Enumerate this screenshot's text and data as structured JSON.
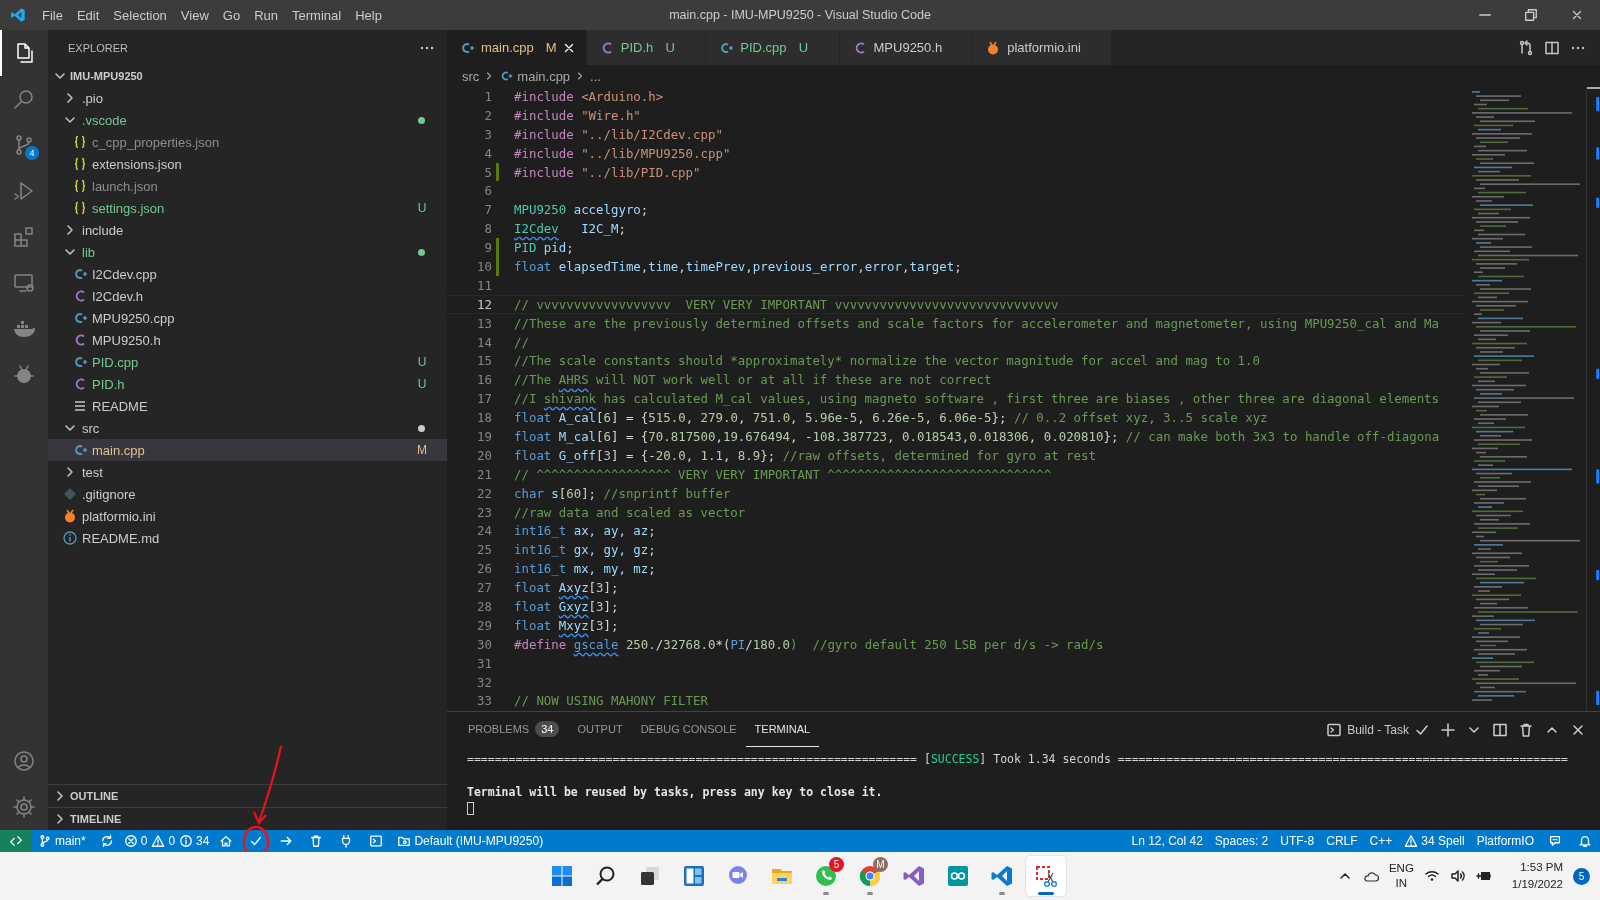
{
  "title_bar": {
    "menu": [
      "File",
      "Edit",
      "Selection",
      "View",
      "Go",
      "Run",
      "Terminal",
      "Help"
    ],
    "title": "main.cpp - IMU-MPU9250 - Visual Studio Code"
  },
  "activity_bar": {
    "items": [
      {
        "kind": "files",
        "selected": true
      },
      {
        "kind": "search",
        "selected": false
      },
      {
        "kind": "source-control",
        "selected": false,
        "badge": "4"
      },
      {
        "kind": "run",
        "selected": false
      },
      {
        "kind": "extensions",
        "selected": false
      },
      {
        "kind": "remote",
        "selected": false
      },
      {
        "kind": "docker",
        "selected": false
      },
      {
        "kind": "platformio",
        "selected": false
      }
    ],
    "bottom": [
      {
        "kind": "account"
      },
      {
        "kind": "settings"
      }
    ]
  },
  "explorer": {
    "title": "EXPLORER",
    "root": {
      "label": "IMU-MPU9250",
      "expanded": true,
      "children": [
        {
          "kind": "folder",
          "label": ".pio",
          "expanded": false,
          "dot": false,
          "color": "#cccccc",
          "selected": false
        },
        {
          "kind": "folder",
          "label": ".vscode",
          "expanded": true,
          "dot": true,
          "color": "#73c991",
          "selected": false,
          "children": [
            {
              "kind": "json",
              "label": "c_cpp_properties.json",
              "color": "#8c8c8c",
              "selected": false
            },
            {
              "kind": "json",
              "label": "extensions.json",
              "color": "#cccccc",
              "selected": false
            },
            {
              "kind": "json",
              "label": "launch.json",
              "color": "#8c8c8c",
              "selected": false
            },
            {
              "kind": "json",
              "label": "settings.json",
              "color": "#73c991",
              "badge": "U",
              "selected": false
            }
          ]
        },
        {
          "kind": "folder",
          "label": "include",
          "expanded": false,
          "dot": false,
          "color": "#cccccc",
          "selected": false
        },
        {
          "kind": "folder",
          "label": "lib",
          "expanded": true,
          "dot": true,
          "color": "#73c991",
          "selected": false,
          "children": [
            {
              "kind": "cpp",
              "label": "I2Cdev.cpp",
              "color": "#cccccc",
              "selected": false
            },
            {
              "kind": "header",
              "label": "I2Cdev.h",
              "color": "#cccccc",
              "selected": false
            },
            {
              "kind": "cpp",
              "label": "MPU9250.cpp",
              "color": "#cccccc",
              "selected": false
            },
            {
              "kind": "header",
              "label": "MPU9250.h",
              "color": "#cccccc",
              "selected": false
            },
            {
              "kind": "cpp",
              "label": "PID.cpp",
              "color": "#73c991",
              "badge": "U",
              "selected": false
            },
            {
              "kind": "header",
              "label": "PID.h",
              "color": "#73c991",
              "badge": "U",
              "selected": false
            },
            {
              "kind": "readme",
              "label": "README",
              "color": "#cccccc",
              "selected": false
            }
          ]
        },
        {
          "kind": "folder",
          "label": "src",
          "expanded": true,
          "dot": true,
          "color": "#cccccc",
          "selected": false,
          "children": [
            {
              "kind": "cpp",
              "label": "main.cpp",
              "color": "#e2c08d",
              "badge": "M",
              "selected": true
            }
          ]
        },
        {
          "kind": "folder",
          "label": "test",
          "expanded": false,
          "dot": false,
          "color": "#cccccc",
          "selected": false
        },
        {
          "kind": "gitignore",
          "label": ".gitignore",
          "color": "#cccccc",
          "selected": false
        },
        {
          "kind": "ini",
          "label": "platformio.ini",
          "color": "#cccccc",
          "selected": false
        },
        {
          "kind": "markdown",
          "label": "README.md",
          "color": "#cccccc",
          "selected": false
        }
      ]
    },
    "sections": [
      {
        "label": "OUTLINE",
        "expanded": false
      },
      {
        "label": "TIMELINE",
        "expanded": false
      }
    ]
  },
  "tabs": [
    {
      "label": "main.cpp",
      "kind": "cpp",
      "color": "#e2c08d",
      "badge": "M",
      "selected": true
    },
    {
      "label": "PID.h",
      "kind": "header",
      "color": "#73c991",
      "badge": "U",
      "selected": false
    },
    {
      "label": "PID.cpp",
      "kind": "cpp",
      "color": "#73c991",
      "badge": "U",
      "selected": false
    },
    {
      "label": "MPU9250.h",
      "kind": "header",
      "color": "#cccccc",
      "selected": false
    },
    {
      "label": "platformio.ini",
      "kind": "ini",
      "color": "#cccccc",
      "selected": false
    }
  ],
  "breadcrumb": [
    {
      "kind": "folder",
      "text": "src"
    },
    {
      "kind": "cpp",
      "text": "main.cpp"
    },
    {
      "kind": "more",
      "text": "..."
    }
  ],
  "code": [
    {
      "number": "1",
      "current": false,
      "tokens": [
        {
          "text": "#include",
          "kind": "pp"
        },
        {
          "text": " <Arduino.h>",
          "kind": "str"
        }
      ]
    },
    {
      "number": "2",
      "current": false,
      "tokens": [
        {
          "text": "#include",
          "kind": "pp"
        },
        {
          "text": " \"Wire.h\"",
          "kind": "str"
        }
      ]
    },
    {
      "number": "3",
      "current": false,
      "tokens": [
        {
          "text": "#include",
          "kind": "pp"
        },
        {
          "text": " \"../lib/I2Cdev.cpp\"",
          "kind": "str"
        }
      ]
    },
    {
      "number": "4",
      "current": false,
      "tokens": [
        {
          "text": "#include",
          "kind": "pp"
        },
        {
          "text": " \"../lib/MPU9250.cpp\"",
          "kind": "str"
        }
      ]
    },
    {
      "number": "5",
      "current": false,
      "added": true,
      "tokens": [
        {
          "text": "#include",
          "kind": "pp"
        },
        {
          "text": " \"../lib/PID.cpp\"",
          "kind": "str"
        }
      ]
    },
    {
      "number": "6",
      "current": false
    },
    {
      "number": "7",
      "current": false,
      "tokens": [
        {
          "text": "MPU9250",
          "kind": "class"
        },
        {
          "text": " accelgyro",
          "kind": "var"
        },
        {
          "text": ";",
          "kind": "plain"
        }
      ]
    },
    {
      "number": "8",
      "current": false,
      "tokens": [
        {
          "text": "I2Cdev",
          "kind": "warnclass"
        },
        {
          "text": "   I2C_M",
          "kind": "var"
        },
        {
          "text": ";",
          "kind": "plain"
        }
      ]
    },
    {
      "number": "9",
      "current": false,
      "added": true,
      "tokens": [
        {
          "text": "PID",
          "kind": "class"
        },
        {
          "text": " pid",
          "kind": "var"
        },
        {
          "text": ";",
          "kind": "plain"
        }
      ]
    },
    {
      "number": "10",
      "current": false,
      "added": true,
      "tokens": [
        {
          "text": "float",
          "kind": "type"
        },
        {
          "text": " elapsedTime",
          "kind": "var"
        },
        {
          "text": ",",
          "kind": "plain"
        },
        {
          "text": "time",
          "kind": "var"
        },
        {
          "text": ",",
          "kind": "plain"
        },
        {
          "text": "timePrev",
          "kind": "var"
        },
        {
          "text": ",",
          "kind": "plain"
        },
        {
          "text": "previous_error",
          "kind": "var"
        },
        {
          "text": ",",
          "kind": "plain"
        },
        {
          "text": "error",
          "kind": "var"
        },
        {
          "text": ",",
          "kind": "plain"
        },
        {
          "text": "target",
          "kind": "var"
        },
        {
          "text": ";",
          "kind": "plain"
        }
      ]
    },
    {
      "number": "11",
      "current": false
    },
    {
      "number": "12",
      "current": true,
      "tokens": [
        {
          "text": "// vvvvvvvvvvvvvvvvvv  VERY VERY IMPORTANT vvvvvvvvvvvvvvvvvvvvvvvvvvvvvv",
          "kind": "com"
        }
      ]
    },
    {
      "number": "13",
      "current": false,
      "tokens": [
        {
          "text": "//These are the previously determined offsets and scale factors for accelerometer and magnetometer, using MPU9250_cal and Ma",
          "kind": "com"
        }
      ]
    },
    {
      "number": "14",
      "current": false,
      "tokens": [
        {
          "text": "//",
          "kind": "com"
        }
      ]
    },
    {
      "number": "15",
      "current": false,
      "tokens": [
        {
          "text": "//The scale constants should *approximately* normalize the vector magnitude for accel and mag to 1.0",
          "kind": "com"
        }
      ]
    },
    {
      "number": "16",
      "current": false,
      "tokens": [
        {
          "text": "//The ",
          "kind": "com"
        },
        {
          "text": "AHRS",
          "kind": "comwarn"
        },
        {
          "text": " will NOT work well or at all if these are not correct",
          "kind": "com"
        }
      ]
    },
    {
      "number": "17",
      "current": false,
      "tokens": [
        {
          "text": "//I ",
          "kind": "com"
        },
        {
          "text": "shivank",
          "kind": "comwarn"
        },
        {
          "text": " has calculated M_cal values, using magneto software , first three are biases , other three are diagonal elements",
          "kind": "com"
        }
      ]
    },
    {
      "number": "18",
      "current": false,
      "tokens": [
        {
          "text": "float",
          "kind": "type"
        },
        {
          "text": " A_cal",
          "kind": "var"
        },
        {
          "text": "[",
          "kind": "plain"
        },
        {
          "text": "6",
          "kind": "num"
        },
        {
          "text": "] = {",
          "kind": "plain"
        },
        {
          "text": "515.0",
          "kind": "num"
        },
        {
          "text": ", ",
          "kind": "plain"
        },
        {
          "text": "279.0",
          "kind": "num"
        },
        {
          "text": ", ",
          "kind": "plain"
        },
        {
          "text": "751.0",
          "kind": "num"
        },
        {
          "text": ", ",
          "kind": "plain"
        },
        {
          "text": "5.96e-5",
          "kind": "num"
        },
        {
          "text": ", ",
          "kind": "plain"
        },
        {
          "text": "6.26e-5",
          "kind": "num"
        },
        {
          "text": ", ",
          "kind": "plain"
        },
        {
          "text": "6.06e-5",
          "kind": "num"
        },
        {
          "text": "}; ",
          "kind": "plain"
        },
        {
          "text": "// 0..2 offset xyz, 3..5 scale xyz",
          "kind": "com"
        }
      ]
    },
    {
      "number": "19",
      "current": false,
      "tokens": [
        {
          "text": "float",
          "kind": "type"
        },
        {
          "text": " M_cal",
          "kind": "var"
        },
        {
          "text": "[",
          "kind": "plain"
        },
        {
          "text": "6",
          "kind": "num"
        },
        {
          "text": "] = {",
          "kind": "plain"
        },
        {
          "text": "70.817500",
          "kind": "num"
        },
        {
          "text": ",",
          "kind": "plain"
        },
        {
          "text": "19.676494",
          "kind": "num"
        },
        {
          "text": ", -",
          "kind": "plain"
        },
        {
          "text": "108.387723",
          "kind": "num"
        },
        {
          "text": ", ",
          "kind": "plain"
        },
        {
          "text": "0.018543",
          "kind": "num"
        },
        {
          "text": ",",
          "kind": "plain"
        },
        {
          "text": "0.018306",
          "kind": "num"
        },
        {
          "text": ", ",
          "kind": "plain"
        },
        {
          "text": "0.020810",
          "kind": "num"
        },
        {
          "text": "}; ",
          "kind": "plain"
        },
        {
          "text": "// can make both 3x3 to handle off-diagona",
          "kind": "com"
        }
      ]
    },
    {
      "number": "20",
      "current": false,
      "tokens": [
        {
          "text": "float",
          "kind": "type"
        },
        {
          "text": " G_off",
          "kind": "var"
        },
        {
          "text": "[",
          "kind": "plain"
        },
        {
          "text": "3",
          "kind": "num"
        },
        {
          "text": "] = {-",
          "kind": "plain"
        },
        {
          "text": "20.0",
          "kind": "num"
        },
        {
          "text": ", ",
          "kind": "plain"
        },
        {
          "text": "1.1",
          "kind": "num"
        },
        {
          "text": ", ",
          "kind": "plain"
        },
        {
          "text": "8.9",
          "kind": "num"
        },
        {
          "text": "}; ",
          "kind": "plain"
        },
        {
          "text": "//raw offsets, determined for gyro at rest",
          "kind": "com"
        }
      ]
    },
    {
      "number": "21",
      "current": false,
      "tokens": [
        {
          "text": "// ^^^^^^^^^^^^^^^^^^ VERY VERY IMPORTANT ^^^^^^^^^^^^^^^^^^^^^^^^^^^^^^",
          "kind": "com"
        }
      ]
    },
    {
      "number": "22",
      "current": false,
      "tokens": [
        {
          "text": "char",
          "kind": "type"
        },
        {
          "text": " s",
          "kind": "var"
        },
        {
          "text": "[",
          "kind": "plain"
        },
        {
          "text": "60",
          "kind": "num"
        },
        {
          "text": "]; ",
          "kind": "plain"
        },
        {
          "text": "//snprintf buffer",
          "kind": "com"
        }
      ]
    },
    {
      "number": "23",
      "current": false,
      "tokens": [
        {
          "text": "//raw data and scaled as vector",
          "kind": "com"
        }
      ]
    },
    {
      "number": "24",
      "current": false,
      "tokens": [
        {
          "text": "int16_t",
          "kind": "type"
        },
        {
          "text": " ax, ay, az",
          "kind": "var"
        },
        {
          "text": ";",
          "kind": "plain"
        }
      ]
    },
    {
      "number": "25",
      "current": false,
      "tokens": [
        {
          "text": "int16_t",
          "kind": "type"
        },
        {
          "text": " gx, gy, gz",
          "kind": "var"
        },
        {
          "text": ";",
          "kind": "plain"
        }
      ]
    },
    {
      "number": "26",
      "current": false,
      "tokens": [
        {
          "text": "int16_t",
          "kind": "type"
        },
        {
          "text": " mx, my, mz",
          "kind": "var"
        },
        {
          "text": ";",
          "kind": "plain"
        }
      ]
    },
    {
      "number": "27",
      "current": false,
      "tokens": [
        {
          "text": "float ",
          "kind": "type"
        },
        {
          "text": "Axyz",
          "kind": "warn"
        },
        {
          "text": "[",
          "kind": "plain"
        },
        {
          "text": "3",
          "kind": "num"
        },
        {
          "text": "];",
          "kind": "plain"
        }
      ]
    },
    {
      "number": "28",
      "current": false,
      "tokens": [
        {
          "text": "float ",
          "kind": "type"
        },
        {
          "text": "Gxyz",
          "kind": "warn"
        },
        {
          "text": "[",
          "kind": "plain"
        },
        {
          "text": "3",
          "kind": "num"
        },
        {
          "text": "];",
          "kind": "plain"
        }
      ]
    },
    {
      "number": "29",
      "current": false,
      "tokens": [
        {
          "text": "float ",
          "kind": "type"
        },
        {
          "text": "Mxyz",
          "kind": "warn"
        },
        {
          "text": "[",
          "kind": "plain"
        },
        {
          "text": "3",
          "kind": "num"
        },
        {
          "text": "];",
          "kind": "plain"
        }
      ]
    },
    {
      "number": "30",
      "current": false,
      "tokens": [
        {
          "text": "#define ",
          "kind": "pp"
        },
        {
          "text": "gscale",
          "kind": "warnmacro"
        },
        {
          "text": " 250.",
          "kind": "num"
        },
        {
          "text": "/",
          "kind": "plain"
        },
        {
          "text": "32768.0",
          "kind": "num"
        },
        {
          "text": "*(",
          "kind": "plain"
        },
        {
          "text": "PI",
          "kind": "macro"
        },
        {
          "text": "/",
          "kind": "plain"
        },
        {
          "text": "180.0",
          "kind": "num"
        },
        {
          "text": ")  //gyro default 250 LSB per d/s -> rad/s",
          "kind": "com"
        }
      ]
    },
    {
      "number": "31",
      "current": false
    },
    {
      "number": "32",
      "current": false
    },
    {
      "number": "33",
      "current": false,
      "tokens": [
        {
          "text": "// NOW USING MAHONY FILTER",
          "kind": "com"
        }
      ]
    }
  ],
  "panel": {
    "tabs": [
      {
        "label": "PROBLEMS",
        "badge": "34",
        "selected": false
      },
      {
        "label": "OUTPUT",
        "selected": false
      },
      {
        "label": "DEBUG CONSOLE",
        "selected": false
      },
      {
        "label": "TERMINAL",
        "selected": true
      }
    ],
    "task": "Build - Task",
    "terminal": {
      "cursor": true,
      "lines": [
        {
          "tokens": [
            {
              "text": "================================================================= [",
              "kind": "plain"
            },
            {
              "text": "SUCCESS",
              "kind": "success"
            },
            {
              "text": "] Took 1.34 seconds =================================================================",
              "kind": "plain"
            }
          ]
        },
        {
          "tokens": [
            {
              "text": "Terminal will be reused by tasks, press any key to close it.",
              "kind": "bold"
            }
          ]
        }
      ]
    }
  },
  "status_bar": {
    "left": [
      {
        "kind": "remote"
      },
      {
        "kind": "branch",
        "text": "main*"
      },
      {
        "kind": "sync"
      },
      {
        "kind": "errors",
        "text": "0"
      },
      {
        "kind": "warnings",
        "text": "0"
      },
      {
        "kind": "infos",
        "text": "34"
      },
      {
        "kind": "home"
      },
      {
        "kind": "check"
      },
      {
        "kind": "arrow"
      },
      {
        "kind": "trash"
      },
      {
        "kind": "plug"
      },
      {
        "kind": "terminal"
      },
      {
        "kind": "env",
        "text": "Default (IMU-MPU9250)"
      }
    ],
    "right": [
      {
        "kind": "text",
        "text": "Ln 12, Col 42"
      },
      {
        "kind": "text",
        "text": "Spaces: 2"
      },
      {
        "kind": "text",
        "text": "UTF-8"
      },
      {
        "kind": "text",
        "text": "CRLF"
      },
      {
        "kind": "text",
        "text": "C++"
      },
      {
        "kind": "warnings",
        "text": "34 Spell"
      },
      {
        "kind": "text",
        "text": "PlatformIO"
      },
      {
        "kind": "feedback"
      },
      {
        "kind": "bell"
      }
    ]
  },
  "annotation": {
    "arrow": true,
    "circle": true
  },
  "taskbar": {
    "apps": [
      {
        "kind": "start",
        "running": false,
        "active": false
      },
      {
        "kind": "search",
        "running": false,
        "active": false
      },
      {
        "kind": "taskview",
        "running": false,
        "active": false
      },
      {
        "kind": "widgets",
        "running": false,
        "active": false
      },
      {
        "kind": "chat",
        "running": false,
        "active": false
      },
      {
        "kind": "files",
        "running": false,
        "active": false
      },
      {
        "kind": "messenger",
        "running": true,
        "active": false,
        "badge": "5"
      },
      {
        "kind": "browser",
        "running": true,
        "active": false,
        "badge": "M"
      },
      {
        "kind": "ide",
        "running": false,
        "active": false
      },
      {
        "kind": "arduino",
        "running": false,
        "active": false
      },
      {
        "kind": "editor",
        "running": true,
        "active": false
      },
      {
        "kind": "snip",
        "running": true,
        "active": true
      }
    ],
    "tray": {
      "language": [
        "ENG",
        "IN"
      ],
      "time": "1:53 PM",
      "date": "1/19/2022",
      "notifications": "5"
    }
  }
}
